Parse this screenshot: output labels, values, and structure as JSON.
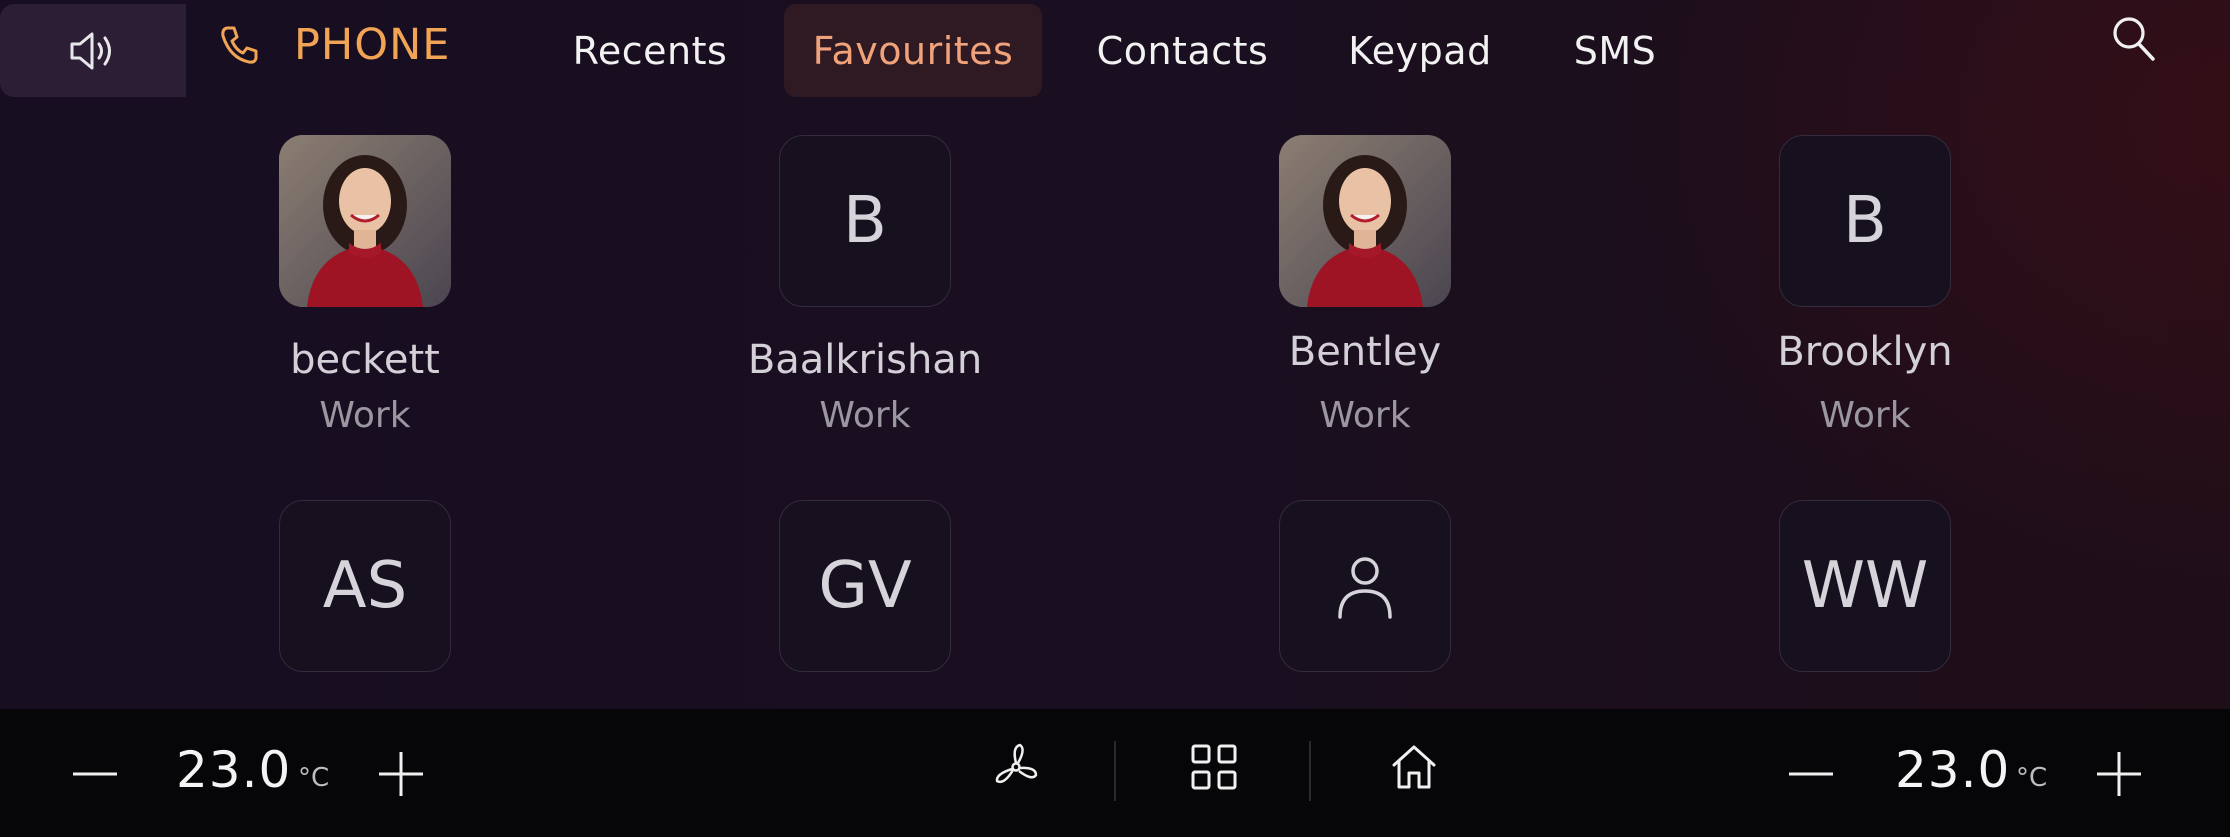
{
  "header": {
    "app_title": "PHONE",
    "speaker_icon": "speaker-icon",
    "phone_icon": "phone-icon",
    "search_icon": "search-icon"
  },
  "tabs": [
    {
      "label": "Recents",
      "active": false
    },
    {
      "label": "Favourites",
      "active": true
    },
    {
      "label": "Contacts",
      "active": false
    },
    {
      "label": "Keypad",
      "active": false
    },
    {
      "label": "SMS",
      "active": false
    }
  ],
  "favourites": [
    {
      "name": "beckett",
      "type": "Work",
      "avatar": "photo"
    },
    {
      "name": "Baalkrishan",
      "type": "Work",
      "avatar": "B"
    },
    {
      "name": "Bentley",
      "type": "Work",
      "avatar": "photo"
    },
    {
      "name": "Brooklyn",
      "type": "Work",
      "avatar": "B"
    },
    {
      "avatar": "AS"
    },
    {
      "avatar": "GV"
    },
    {
      "avatar": "person-icon"
    },
    {
      "avatar": "WW"
    }
  ],
  "climate": {
    "left_temp": "23.0",
    "right_temp": "23.0",
    "unit": "°C",
    "icons": [
      "minus-icon",
      "plus-icon",
      "fan-icon",
      "apps-grid-icon",
      "home-icon"
    ]
  },
  "colors": {
    "accent": "#f2a455",
    "active_tab_text": "#f0a27a",
    "active_tab_bg": "#2f1a24",
    "background": "#170e21",
    "climate_bar": "#060608"
  }
}
